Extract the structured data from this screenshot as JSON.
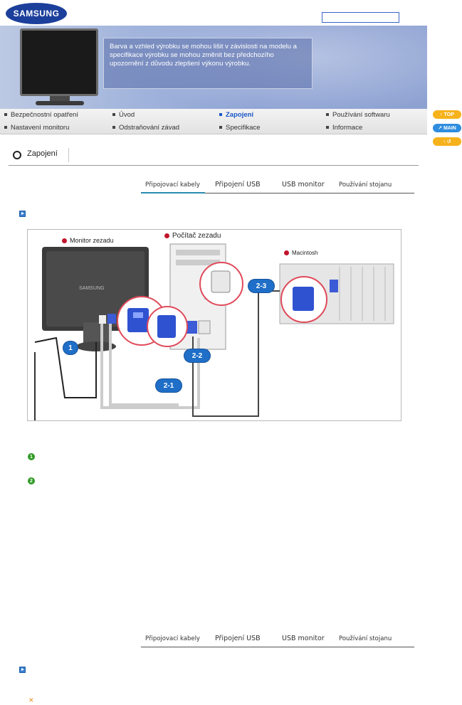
{
  "header": {
    "logo_text": "SAMSUNG"
  },
  "banner": {
    "note": "Barva a vzhled výrobku se mohou lišit v závislosti na modelu a specifikace výrobku se mohou změnit bez předchozího upozornění z důvodu zlepšení výkonu výrobku."
  },
  "nav": {
    "row1": [
      "Bezpečnostní opatření",
      "Úvod",
      "Zapojení",
      "Používání softwaru"
    ],
    "row2": [
      "Nastavení monitoru",
      "Odstraňování závad",
      "Specifikace",
      "Informace"
    ],
    "active": "Zapojení"
  },
  "side_buttons": {
    "top": "TOP",
    "main": "MAIN",
    "back": "↑ ↺"
  },
  "section": {
    "title": "Zapojení"
  },
  "tabs": {
    "items": [
      "Připojovací kabely",
      "Připojení USB",
      "USB monitor",
      "Používání stojanu"
    ],
    "active": "Připojovací kabely"
  },
  "diagram": {
    "labels": {
      "monitor_rear": "Monitor zezadu",
      "pc_rear": "Počítač zezadu",
      "mac": "Macintosh",
      "monitor_brand": "SAMSUNG"
    },
    "badges": [
      "1",
      "2-1",
      "2-2",
      "2-3"
    ]
  },
  "steps": {
    "icon1": "1",
    "icon2": "2"
  },
  "colors": {
    "nav_active": "#1a56c8",
    "badge_blue": "#1f6fc8",
    "dot_red": "#c0152b",
    "step_green": "#2f9a25",
    "top_btn": "#f6b21b",
    "main_btn": "#2f8de0",
    "back_btn": "#f6b21b"
  }
}
